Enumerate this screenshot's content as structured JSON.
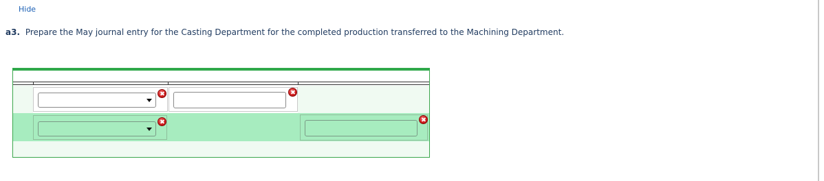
{
  "header": {
    "hide_link": "Hide"
  },
  "question": {
    "number": "a3.",
    "text": "Prepare the May journal entry for the Casting Department for the completed production transferred to the Machining Department."
  },
  "journal_entry": {
    "rows": [
      {
        "account_select_value": "",
        "debit_value": "",
        "credit_value": "",
        "account_status": "incorrect",
        "amount_status": "incorrect"
      },
      {
        "account_select_value": "",
        "debit_value": "",
        "credit_value": "",
        "account_status": "incorrect",
        "amount_status": "incorrect"
      }
    ],
    "colors": {
      "accent_bar": "#2fa84a",
      "highlight_row": "#a7ecbf",
      "error_icon": "#d21e1e"
    },
    "icons": [
      "error-x-icon",
      "dropdown-arrow-icon"
    ]
  }
}
